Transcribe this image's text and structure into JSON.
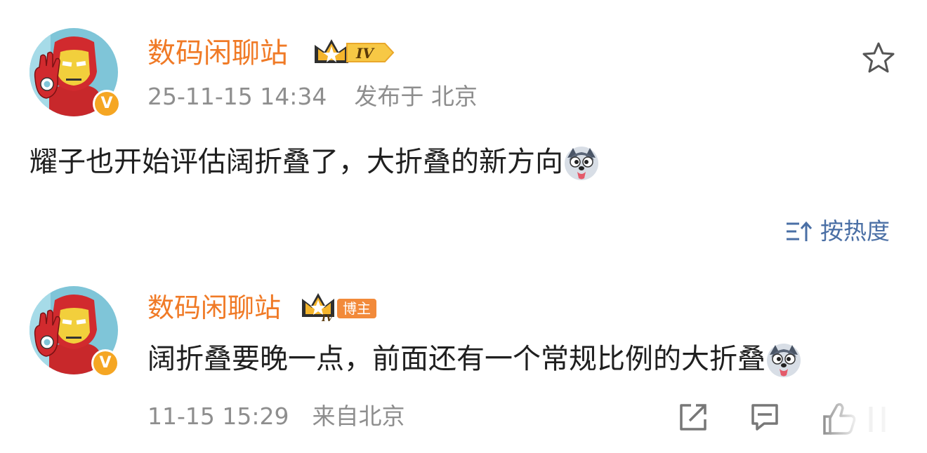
{
  "post": {
    "author": "数码闲聊站",
    "level_badge": "IV",
    "timestamp": "25-11-15 14:34",
    "location": "发布于 北京",
    "text": "耀子也开始评估阔折叠了，大折叠的新方向",
    "emoji": "doge-emoji",
    "favorite_icon": "star-outline-icon"
  },
  "sort": {
    "label": "按热度",
    "icon": "sort-icon"
  },
  "comment": {
    "author": "数码闲聊站",
    "role_badge": "博主",
    "level_badge": "IV",
    "text": "阔折叠要晚一点，前面还有一个常规比例的大折叠",
    "timestamp": "11-15 15:29",
    "source": "来自北京",
    "actions": [
      "share-icon",
      "comment-icon",
      "like-icon"
    ]
  },
  "colors": {
    "name": "#f07a26",
    "meta": "#8e8e8e",
    "sort": "#4a6fa5",
    "verified": "#f5a623"
  }
}
